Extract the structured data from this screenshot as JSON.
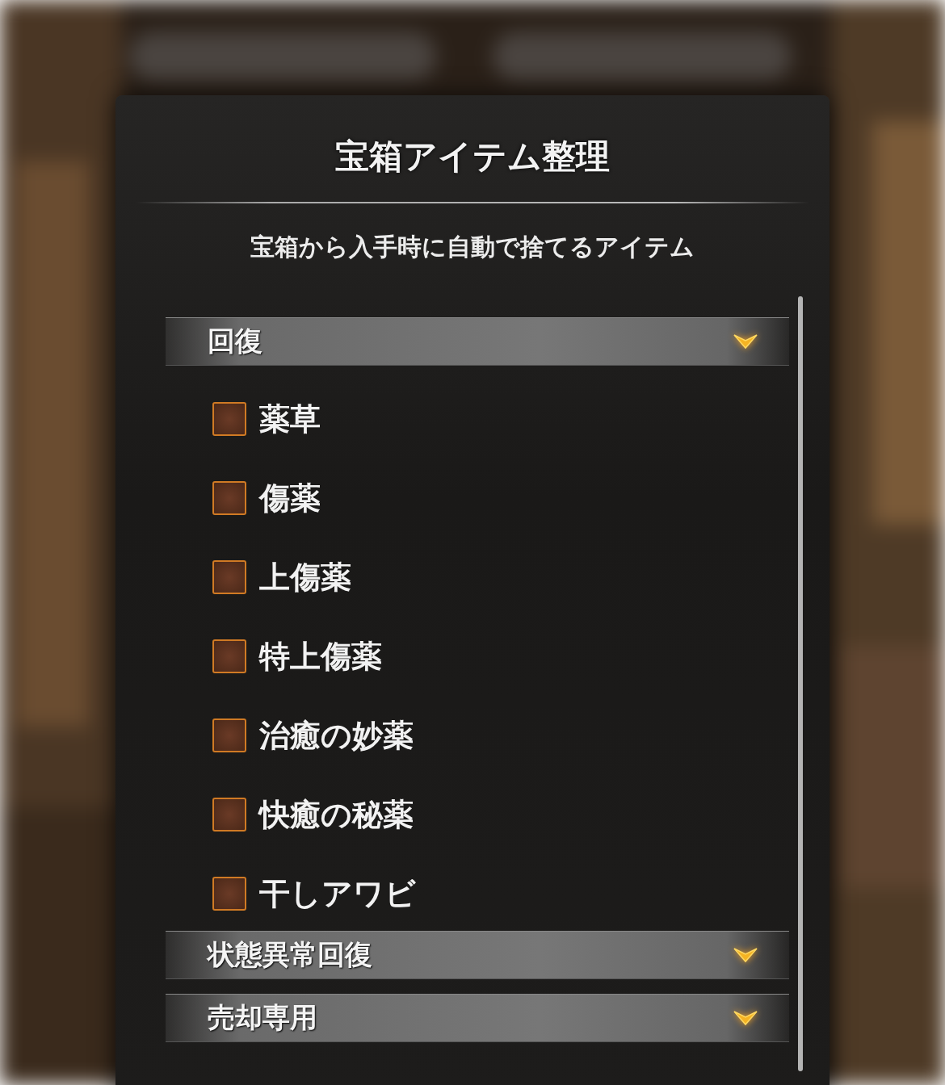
{
  "dialog": {
    "title": "宝箱アイテム整理",
    "subtitle": "宝箱から入手時に自動で捨てるアイテム"
  },
  "sections": [
    {
      "label": "回復",
      "items": [
        {
          "label": "薬草",
          "checked": false
        },
        {
          "label": "傷薬",
          "checked": false
        },
        {
          "label": "上傷薬",
          "checked": false
        },
        {
          "label": "特上傷薬",
          "checked": false
        },
        {
          "label": "治癒の妙薬",
          "checked": false
        },
        {
          "label": "快癒の秘薬",
          "checked": false
        },
        {
          "label": "干しアワビ",
          "checked": false
        }
      ]
    },
    {
      "label": "状態異常回復"
    },
    {
      "label": "売却専用"
    }
  ]
}
